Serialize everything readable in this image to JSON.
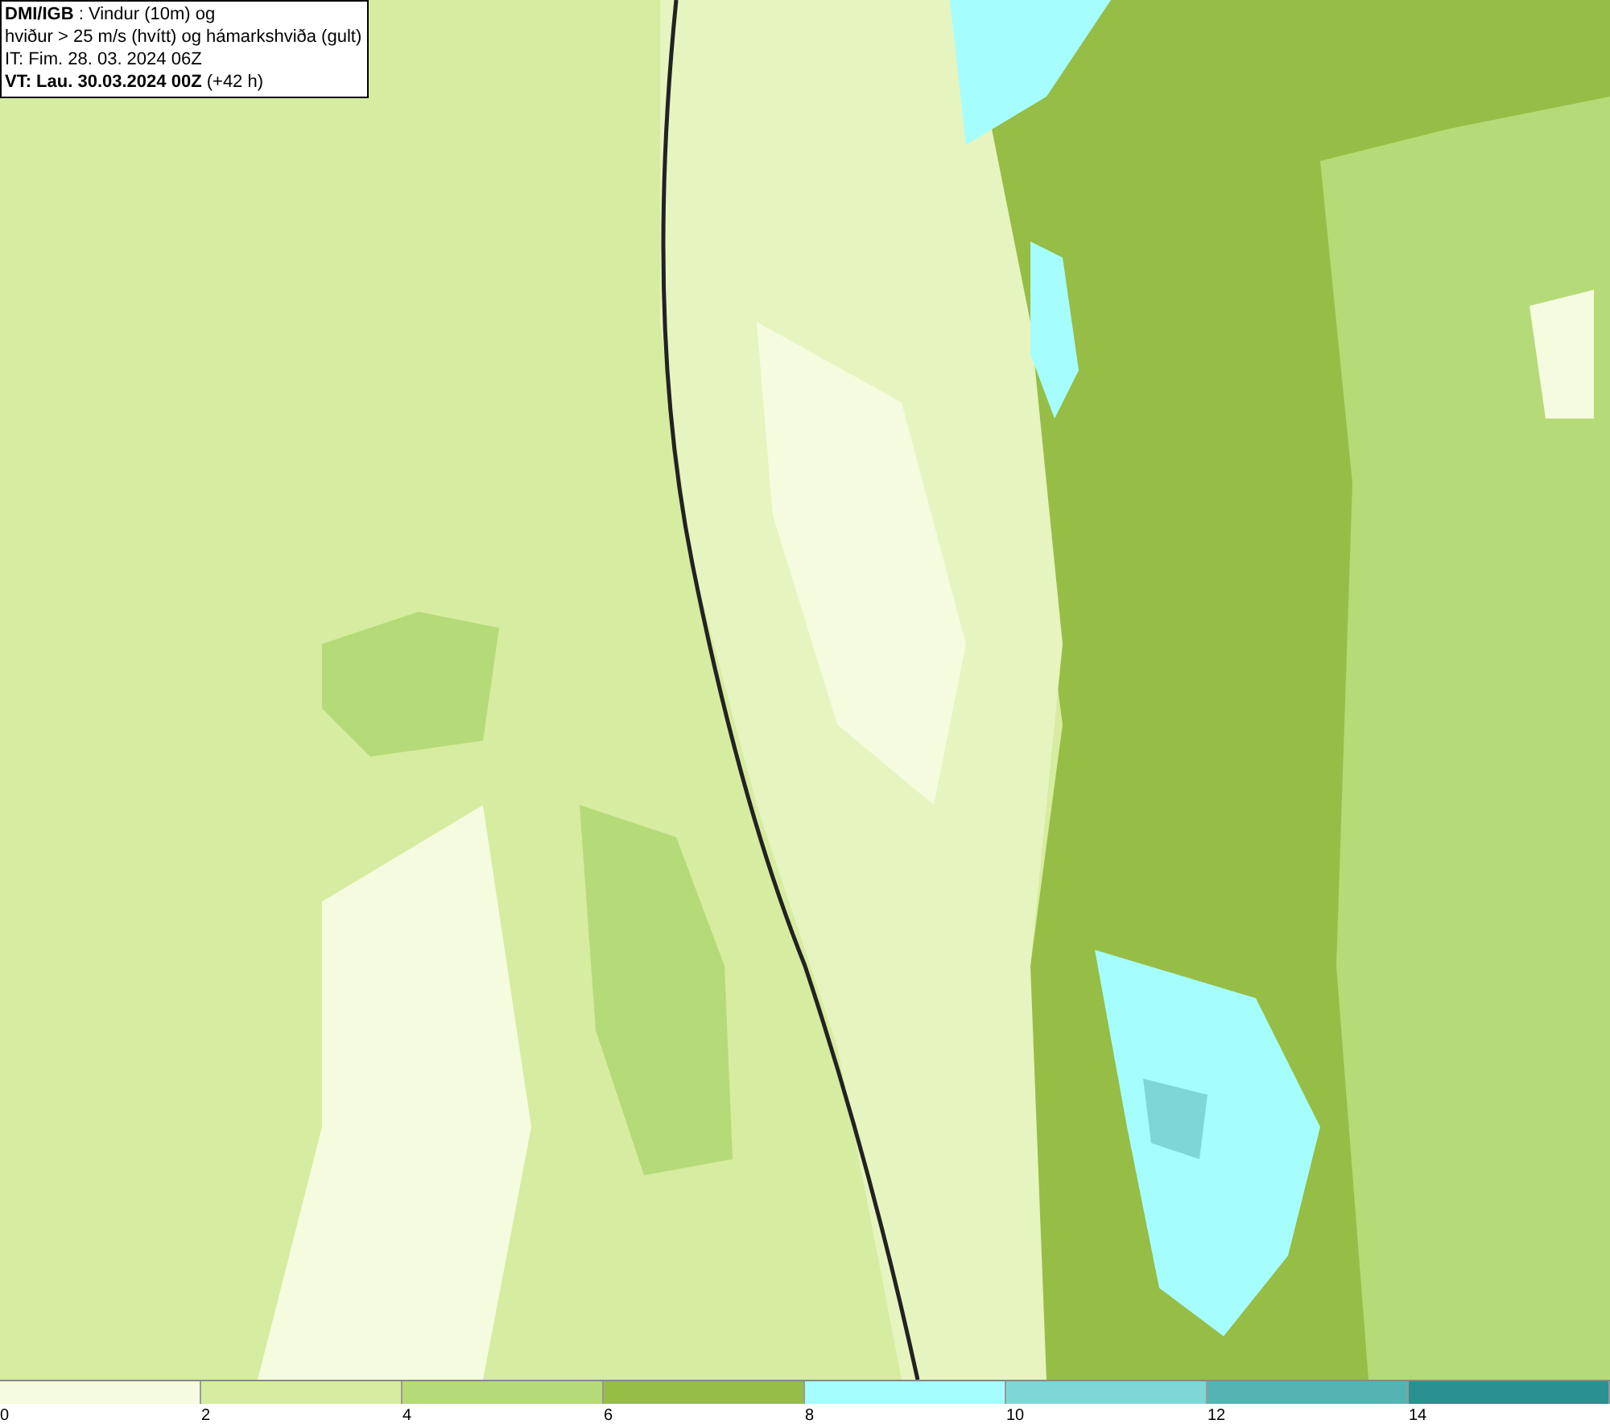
{
  "title_box": {
    "lines": [
      "**DMI/IGB** : Vindur (10m) og",
      "hviður > 25 m/s (hvítt) og hámarkshviða (gult)",
      "IT: Fim. 28. 03. 2024 06Z",
      "**VT: Lau. 30.03.2024 00Z** (+42 h)"
    ]
  },
  "legend": {
    "swatches": [
      {
        "color": "#f5fbdf"
      },
      {
        "color": "#d6eca0"
      },
      {
        "color": "#b5da78"
      },
      {
        "color": "#96bd45"
      },
      {
        "color": "#a6fdfd"
      },
      {
        "color": "#7fd6d6"
      },
      {
        "color": "#55b3b3"
      },
      {
        "color": "#2a9090"
      }
    ],
    "ticks": [
      "0",
      "2",
      "4",
      "6",
      "8",
      "10",
      "12",
      "14"
    ]
  }
}
